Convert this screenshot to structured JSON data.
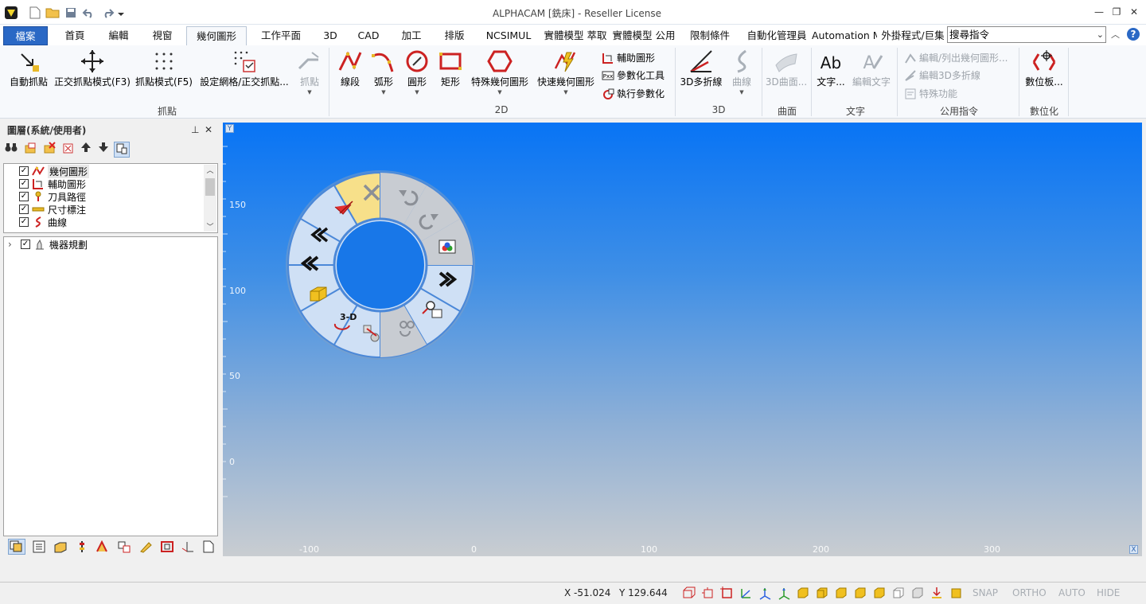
{
  "app": {
    "title": "ALPHACAM [銑床] - Reseller License",
    "window_controls": {
      "minimize": "—",
      "restore": "❐",
      "close": "✕"
    }
  },
  "tabs": [
    {
      "label": "檔案"
    },
    {
      "label": "首頁"
    },
    {
      "label": "編輯"
    },
    {
      "label": "視窗"
    },
    {
      "label": "幾何圖形"
    },
    {
      "label": "工作平面"
    },
    {
      "label": "3D"
    },
    {
      "label": "CAD"
    },
    {
      "label": "加工"
    },
    {
      "label": "排版"
    },
    {
      "label": "NCSIMUL"
    },
    {
      "label": "實體模型 萃取"
    },
    {
      "label": "實體模型 公用"
    },
    {
      "label": "限制條件"
    },
    {
      "label": "自動化管理員"
    },
    {
      "label": "Automation M"
    },
    {
      "label": "外掛程式/巨集"
    }
  ],
  "search": {
    "placeholder": "搜尋指令"
  },
  "ribbon": {
    "snap_group": {
      "label": "抓點",
      "auto_snap": "自動抓點",
      "ortho_snap": "正交抓點模式(F3)",
      "snap_mode": "抓點模式(F5)",
      "grid_set": "設定網格/正交抓點...",
      "snap": "抓點"
    },
    "twod_group": {
      "label": "2D",
      "line": "線段",
      "arc": "弧形",
      "circle": "圓形",
      "rect": "矩形",
      "special": "特殊幾何圖形",
      "quick": "快速幾何圖形",
      "aux": "輔助圖形",
      "param_tool": "參數化工具",
      "run_param": "執行參數化"
    },
    "threed_group": {
      "label": "3D",
      "polyline3d": "3D多折線",
      "curve": "曲線"
    },
    "surface_group": {
      "label": "曲面",
      "surface3d": "3D曲面..."
    },
    "text_group": {
      "label": "文字",
      "text": "文字...",
      "edit_text": "編輯文字"
    },
    "util_group": {
      "label": "公用指令",
      "edit_list": "編輯/列出幾何圖形...",
      "edit3d": "編輯3D多折線",
      "special": "特殊功能"
    },
    "digit_group": {
      "label": "數位化",
      "tablet": "數位板..."
    }
  },
  "layers_panel": {
    "title": "圖層(系統/使用者)",
    "pin": "⊥",
    "close": "✕",
    "layers": [
      {
        "label": "幾何圖形",
        "checked": "✓"
      },
      {
        "label": "輔助圖形",
        "checked": "✓"
      },
      {
        "label": "刀具路徑",
        "checked": "✓"
      },
      {
        "label": "尺寸標注",
        "checked": "✓"
      },
      {
        "label": "曲線",
        "checked": "✓"
      }
    ],
    "tree": [
      {
        "label": "機器規劃",
        "checked": "✓",
        "expander": "›"
      }
    ]
  },
  "canvas": {
    "y_axis_label": "Y",
    "x_axis_label": "X",
    "y_ticks": [
      "150",
      "100",
      "50",
      "0"
    ],
    "x_ticks": [
      "-100",
      "0",
      "100",
      "200",
      "300"
    ]
  },
  "status": {
    "x": "X -51.024",
    "y": "Y 129.644",
    "snap": "SNAP",
    "ortho": "ORTHO",
    "auto": "AUTO",
    "hide": "HIDE"
  },
  "colors": {
    "accent": "#2a68c5",
    "canvas_top": "#0874f5",
    "canvas_bottom": "#c9cdd1",
    "wheel_segment": "#cfe0f5",
    "wheel_highlight": "#f7e08a"
  }
}
